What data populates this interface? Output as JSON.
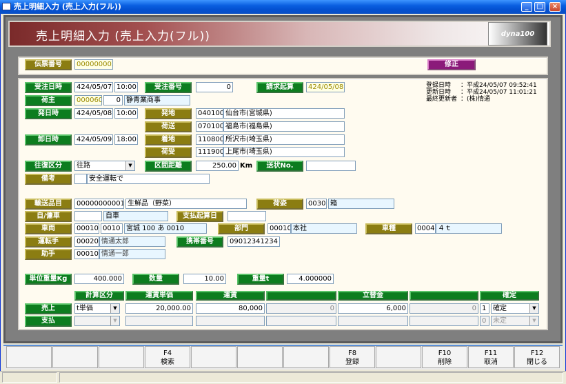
{
  "window": {
    "title": "売上明細入力 (売上入力(フル))",
    "min": "_",
    "max": "□",
    "close": "×"
  },
  "header": {
    "title": "売上明細入力 (売上入力(フル))",
    "logo": "dyna100"
  },
  "top": {
    "denpyo_label": "伝票番号",
    "denpyo_value": "000000002",
    "mode": "修正"
  },
  "meta": {
    "reg_label": "登録日時",
    "reg_value": "：平成24/05/07 09:52:41",
    "upd_label": "更新日時",
    "upd_value": "：平成24/05/07 11:01:21",
    "last_label": "最終更新者",
    "last_value": "：(株)情通"
  },
  "form": {
    "juchu_date_label": "受注日時",
    "juchu_date": "424/05/07",
    "juchu_time": "10:00",
    "juchu_no_label": "受注番号",
    "juchu_no": "0",
    "seikyu_label": "請求起算",
    "seikyu_value": "424/05/08",
    "ninushi_label": "荷主",
    "ninushi_code": "000060",
    "ninushi_sub": "0",
    "ninushi_name": "静青業商事",
    "hatsu_date_label": "発日時",
    "hatsu_date": "424/05/08",
    "hatsu_time": "10:00",
    "hatsuchi_label": "発地",
    "hatsuchi_code": "040100",
    "hatsuchi_name": "仙台市(宮城県)",
    "nisou_label": "荷送",
    "nisou_code": "070100",
    "nisou_name": "福島市(福島県)",
    "oroshi_date_label": "卸日時",
    "oroshi_date": "424/05/09",
    "oroshi_time": "18:00",
    "chakuchi_label": "着地",
    "chakuchi_code": "110800",
    "chakuchi_name": "所沢市(埼玉県)",
    "niuke_label": "荷受",
    "niuke_code": "111900",
    "niuke_name": "上尾市(埼玉県)",
    "oufuku_label": "往復区分",
    "oufuku_value": "往路",
    "kyori_label": "区間距離",
    "kyori_value": "250.00",
    "kyori_unit": "Km",
    "okurijo_label": "送状No.",
    "okurijo_value": "",
    "biko_label": "備考",
    "biko_value": "安全運転で",
    "hinmoku_label": "輸送品目",
    "hinmoku_code": "000000000010",
    "hinmoku_name": "生鮮品（野菜）",
    "nisugata_label": "荷姿",
    "nisugata_code": "0030",
    "nisugata_name": "箱",
    "jiyo_label": "自/傭車",
    "jiyo_value": "自車",
    "shiharai_label": "支払起算日",
    "shiharai_value": "",
    "sharyo_label": "車両",
    "sharyo_code1": "00010",
    "sharyo_code2": "0010",
    "sharyo_name": "宮城 100 あ 0010",
    "bumon_label": "部門",
    "bumon_code": "00010",
    "bumon_name": "本社",
    "shashu_label": "車種",
    "shashu_code": "0004",
    "shashu_name": "４ｔ",
    "driver_label": "運転手",
    "driver_code": "00020",
    "driver_name": "情通太郎",
    "keitai_label": "携帯番号",
    "keitai_value": "09012341234",
    "joshu_label": "助手",
    "joshu_code": "00010",
    "joshu_name": "情通一郎",
    "tani_label": "単位重量Kg",
    "tani_value": "400.000",
    "suryo_label": "数量",
    "suryo_value": "10.00",
    "juryo_label": "重量t",
    "juryo_value": "4.000000"
  },
  "grid": {
    "cols": [
      "計算区分",
      "運賃単価",
      "運賃",
      "",
      "立替金",
      "",
      "確定"
    ],
    "rows": [
      {
        "label": "売上",
        "kubun": "t単価",
        "tanka": "20,000.00",
        "unchin": "80,000",
        "c4": "0",
        "tatekae": "6,000",
        "c6": "0",
        "kakutei_code": "1",
        "kakutei": "確定"
      },
      {
        "label": "支払",
        "kubun": "",
        "tanka": "",
        "unchin": "",
        "c4": "",
        "tatekae": "",
        "c6": "",
        "kakutei_code": "0",
        "kakutei": "未定"
      }
    ]
  },
  "fkeys": {
    "f4": {
      "key": "F4",
      "label": "検索"
    },
    "f8": {
      "key": "F8",
      "label": "登録"
    },
    "f10": {
      "key": "F10",
      "label": "削除"
    },
    "f11": {
      "key": "F11",
      "label": "取消"
    },
    "f12": {
      "key": "F12",
      "label": "閉じる"
    }
  }
}
